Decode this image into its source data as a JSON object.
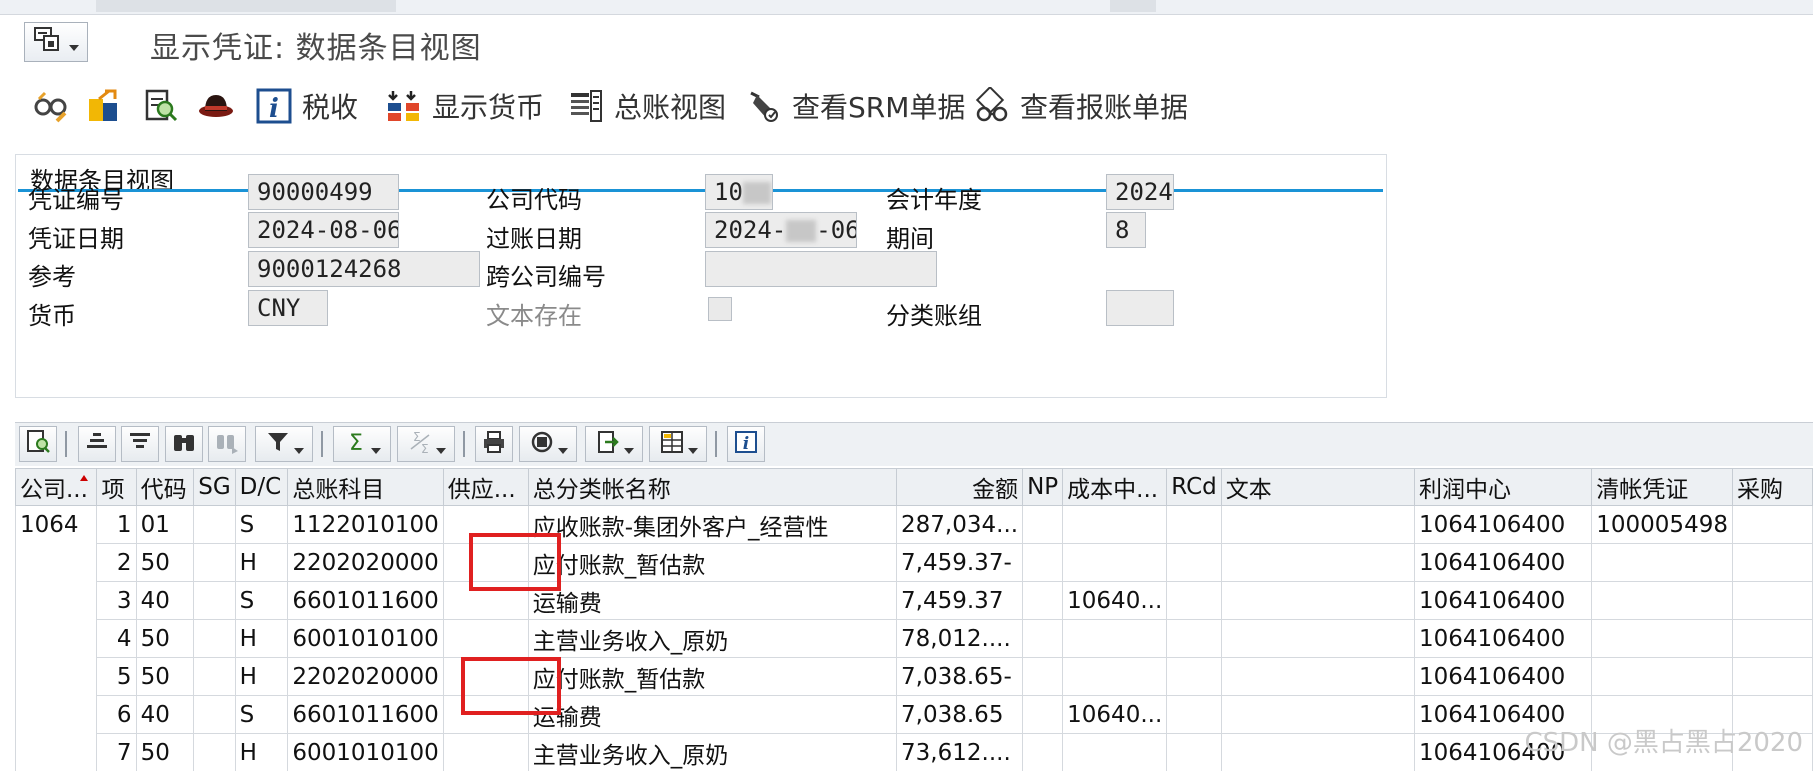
{
  "window": {
    "title": "显示凭证: 数据条目视图"
  },
  "toolbar": {
    "tax_label": "税收",
    "show_currency_label": "显示货币",
    "gl_view_label": "总账视图",
    "srm_label": "查看SRM单据",
    "expense_label": "查看报账单据"
  },
  "header": {
    "group_title": "数据条目视图",
    "doc_no_label": "凭证编号",
    "doc_no": "90000499",
    "company_code_label": "公司代码",
    "company_code": "10",
    "fiscal_year_label": "会计年度",
    "fiscal_year": "2024",
    "doc_date_label": "凭证日期",
    "doc_date": "2024-08-06",
    "posting_date_label": "过账日期",
    "posting_date_prefix": "2024-",
    "posting_date_suffix": "-06",
    "period_label": "期间",
    "period": "8",
    "reference_label": "参考",
    "reference": "9000124268",
    "cross_company_label": "跨公司编号",
    "cross_company": "",
    "currency_label": "货币",
    "currency": "CNY",
    "text_exists_label": "文本存在",
    "ledger_group_label": "分类账组",
    "ledger_group": ""
  },
  "table": {
    "columns": [
      "公司...",
      "项",
      "代码",
      "SG",
      "D/C",
      "总账科目",
      "供应...",
      "总分类帐名称",
      "金额",
      "NP",
      "成本中...",
      "RCd",
      "文本",
      "利润中心",
      "清帐凭证",
      "采购"
    ],
    "company": "1064",
    "rows": [
      {
        "item": "1",
        "code": "01",
        "sg": "",
        "dc": "S",
        "gl": "1122010100",
        "vendor": "",
        "gl_name": "应收账款-集团外客户_经营性",
        "amount": "287,034...",
        "np": "",
        "cost_center": "",
        "rcd": "",
        "text": "",
        "profit_center": "1064106400",
        "clearing_doc": "100005498"
      },
      {
        "item": "2",
        "code": "50",
        "sg": "",
        "dc": "H",
        "gl": "2202020000",
        "vendor": "",
        "gl_name": "应付账款_暂估款",
        "amount": "7,459.37-",
        "np": "",
        "cost_center": "",
        "rcd": "",
        "text": "",
        "profit_center": "1064106400",
        "clearing_doc": ""
      },
      {
        "item": "3",
        "code": "40",
        "sg": "",
        "dc": "S",
        "gl": "6601011600",
        "vendor": "",
        "gl_name": "运输费",
        "amount": "7,459.37",
        "np": "",
        "cost_center": "10640...",
        "rcd": "",
        "text": "",
        "profit_center": "1064106400",
        "clearing_doc": ""
      },
      {
        "item": "4",
        "code": "50",
        "sg": "",
        "dc": "H",
        "gl": "6001010100",
        "vendor": "",
        "gl_name": "主营业务收入_原奶",
        "amount": "78,012....",
        "np": "",
        "cost_center": "",
        "rcd": "",
        "text": "",
        "profit_center": "1064106400",
        "clearing_doc": ""
      },
      {
        "item": "5",
        "code": "50",
        "sg": "",
        "dc": "H",
        "gl": "2202020000",
        "vendor": "",
        "gl_name": "应付账款_暂估款",
        "amount": "7,038.65-",
        "np": "",
        "cost_center": "",
        "rcd": "",
        "text": "",
        "profit_center": "1064106400",
        "clearing_doc": ""
      },
      {
        "item": "6",
        "code": "40",
        "sg": "",
        "dc": "S",
        "gl": "6601011600",
        "vendor": "",
        "gl_name": "运输费",
        "amount": "7,038.65",
        "np": "",
        "cost_center": "10640...",
        "rcd": "",
        "text": "",
        "profit_center": "1064106400",
        "clearing_doc": ""
      },
      {
        "item": "7",
        "code": "50",
        "sg": "",
        "dc": "H",
        "gl": "6001010100",
        "vendor": "",
        "gl_name": "主营业务收入_原奶",
        "amount": "73,612....",
        "np": "",
        "cost_center": "",
        "rcd": "",
        "text": "",
        "profit_center": "1064106400",
        "clearing_doc": ""
      }
    ]
  },
  "watermark": "CSDN @黑占黑占2020",
  "colors": {
    "accent_line": "#1a93d6",
    "highlight_box": "#e02020",
    "field_bg": "#ececec"
  },
  "icons": [
    "command-menu-icon",
    "glasses-icon",
    "export-doc-icon",
    "display-doc-icon",
    "hat-icon",
    "info-icon",
    "currency-icon",
    "gl-view-icon",
    "srm-icon",
    "expense-icon"
  ]
}
